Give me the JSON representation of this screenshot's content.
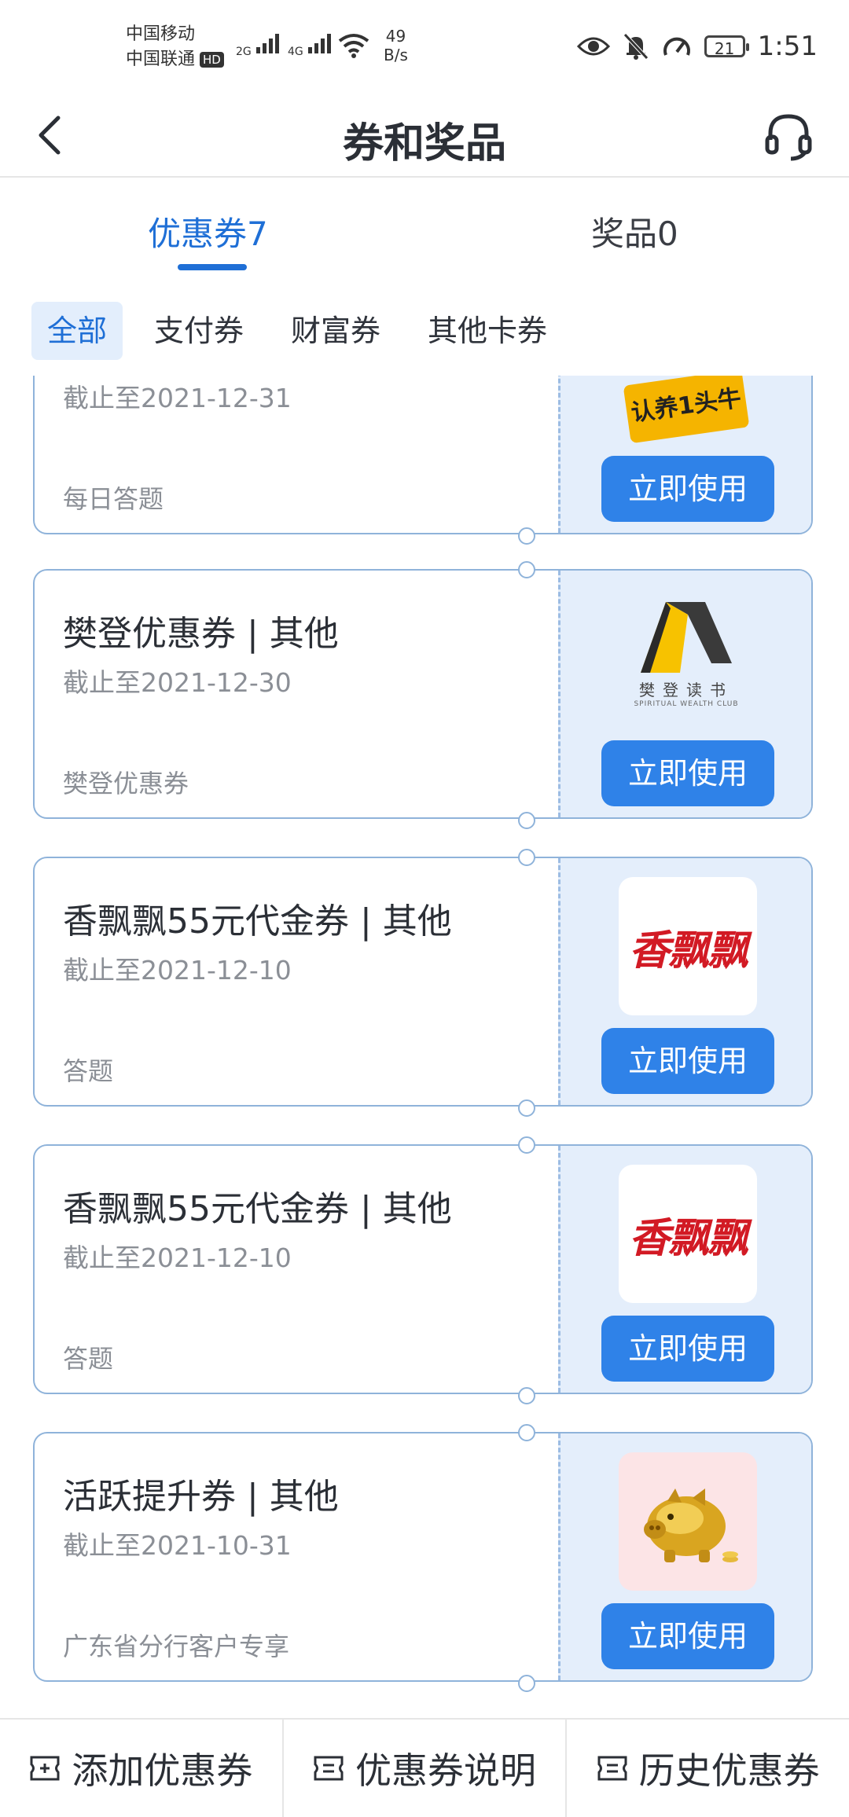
{
  "status_bar": {
    "carrier1": "中国移动",
    "carrier2": "中国联通",
    "hd": "HD",
    "net1": "2G",
    "net2": "4G",
    "speed_value": "49",
    "speed_unit": "B/s",
    "battery": "21",
    "time": "1:51"
  },
  "header": {
    "title": "券和奖品"
  },
  "tabs": [
    {
      "label": "优惠券7",
      "active": true
    },
    {
      "label": "奖品0",
      "active": false
    }
  ],
  "filters": [
    {
      "label": "全部",
      "active": true
    },
    {
      "label": "支付券",
      "active": false
    },
    {
      "label": "财富券",
      "active": false
    },
    {
      "label": "其他卡券",
      "active": false
    }
  ],
  "coupons": [
    {
      "title": "",
      "date": "截止至2021-12-31",
      "source": "每日答题",
      "button": "立即使用",
      "logo": "认养1头牛",
      "logo_icon": "cow-brand-logo"
    },
    {
      "title": "樊登优惠券 | 其他",
      "date": "截止至2021-12-30",
      "source": "樊登优惠券",
      "button": "立即使用",
      "logo": "樊登读书",
      "logo_sub": "SPIRITUAL WEALTH CLUB",
      "logo_icon": "fandeng-logo"
    },
    {
      "title": "香飘飘55元代金券 | 其他",
      "date": "截止至2021-12-10",
      "source": "答题",
      "button": "立即使用",
      "logo": "香飘飘",
      "logo_icon": "xiangpiaopiao-logo"
    },
    {
      "title": "香飘飘55元代金券 | 其他",
      "date": "截止至2021-12-10",
      "source": "答题",
      "button": "立即使用",
      "logo": "香飘飘",
      "logo_icon": "xiangpiaopiao-logo"
    },
    {
      "title": "活跃提升券 | 其他",
      "date": "截止至2021-10-31",
      "source": "广东省分行客户专享",
      "button": "立即使用",
      "logo_icon": "golden-pig-image"
    }
  ],
  "bottom_bar": [
    {
      "label": "添加优惠券",
      "icon": "add-ticket-icon"
    },
    {
      "label": "优惠券说明",
      "icon": "ticket-info-icon"
    },
    {
      "label": "历史优惠券",
      "icon": "ticket-history-icon"
    }
  ],
  "colors": {
    "accent": "#1f6fd6",
    "button": "#2f82e8",
    "coupon_right_bg": "#e4eefb",
    "border": "#8fb3da"
  }
}
